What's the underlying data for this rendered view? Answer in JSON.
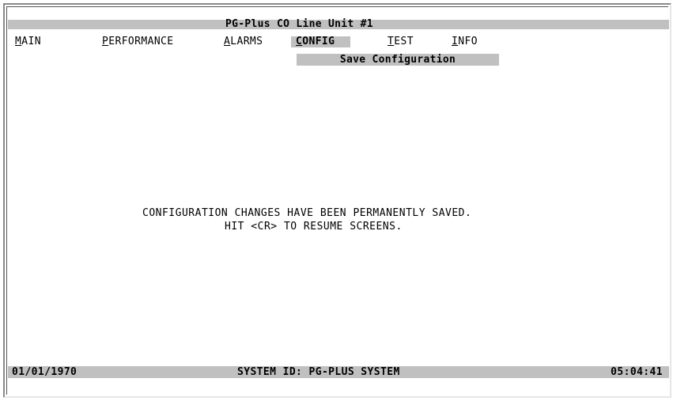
{
  "title": "PG-Plus CO Line Unit #1",
  "menu": [
    {
      "hotkey": "M",
      "rest": "AIN"
    },
    {
      "hotkey": "P",
      "rest": "ERFORMANCE"
    },
    {
      "hotkey": "A",
      "rest": "LARMS"
    },
    {
      "hotkey": "C",
      "rest": "ONFIG"
    },
    {
      "hotkey": "T",
      "rest": "EST"
    },
    {
      "hotkey": "I",
      "rest": "NFO"
    }
  ],
  "active_menu": "CONFIG",
  "submenu": "Save Configuration",
  "message": {
    "line1": "CONFIGURATION CHANGES HAVE BEEN PERMANENTLY SAVED.",
    "line2": "HIT <CR> TO RESUME SCREENS."
  },
  "status": {
    "date": "01/01/1970",
    "system_id": "SYSTEM ID: PG-PLUS SYSTEM",
    "time": "05:04:41"
  },
  "colors": {
    "bar_gray": "#c0c0c0",
    "text": "#000000",
    "background": "#ffffff"
  }
}
